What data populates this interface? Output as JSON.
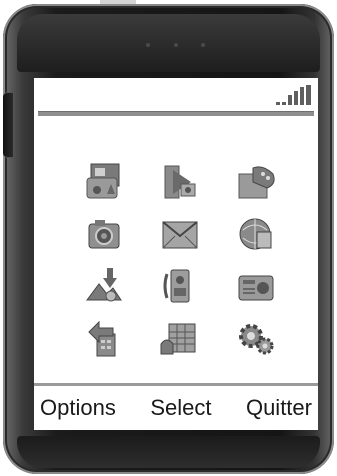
{
  "status": {
    "signal_bars": 5
  },
  "menu": {
    "icons": [
      {
        "name": "media-gallery-icon"
      },
      {
        "name": "video-player-icon"
      },
      {
        "name": "games-icon"
      },
      {
        "name": "camera-icon"
      },
      {
        "name": "messages-icon"
      },
      {
        "name": "web-browser-icon"
      },
      {
        "name": "downloads-icon"
      },
      {
        "name": "contacts-icon"
      },
      {
        "name": "radio-icon"
      },
      {
        "name": "sync-icon"
      },
      {
        "name": "organizer-icon"
      },
      {
        "name": "settings-icon"
      }
    ]
  },
  "softkeys": {
    "left": "Options",
    "center": "Select",
    "right": "Quitter"
  },
  "colors": {
    "screen": "#ffffff",
    "icon": "#6e6e6e",
    "body": "#151515"
  }
}
